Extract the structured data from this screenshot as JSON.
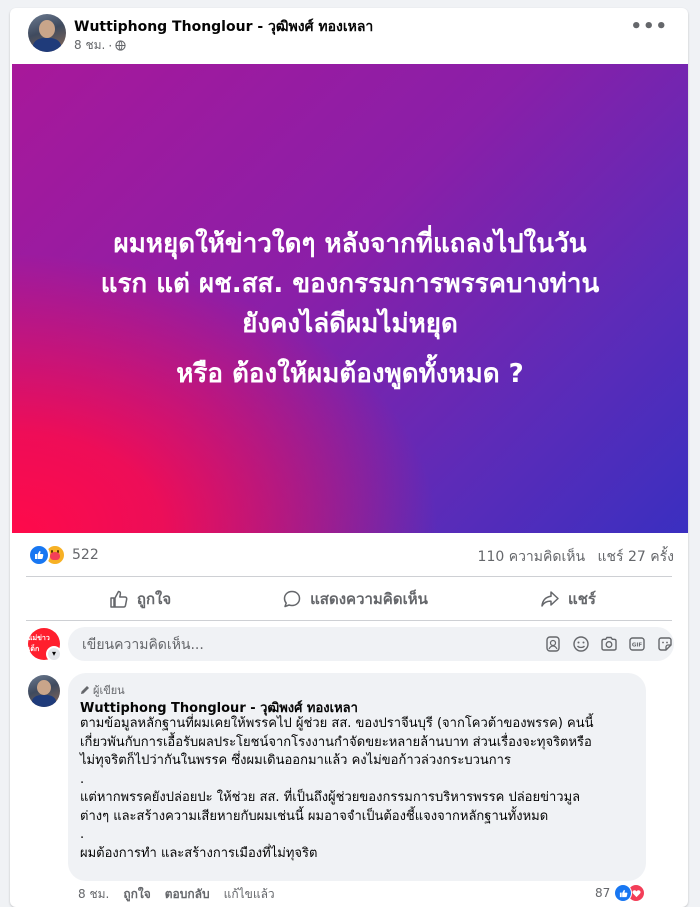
{
  "post": {
    "author": "Wuttiphong Thonglour - วุฒิพงศ์ ทองเหลา",
    "time": "8 ชม.",
    "separator": "·",
    "banner": {
      "line1": "ผมหยุดให้ข่าวใดๆ หลังจากที่แถลงไปในวัน",
      "line2": "แรก แต่ ผช.สส. ของกรรมการพรรคบางท่าน",
      "line3": "ยังคงไล่ดีผมไม่หยุด",
      "line4": "หรือ ต้องให้ผมต้องพูดทั้งหมด ?",
      "colors": [
        "#ff0a4a",
        "#a8189a",
        "#3a2fc0"
      ]
    }
  },
  "stats": {
    "reactions": "522",
    "comments": "110 ความคิดเห็น",
    "shares": "แชร์ 27 ครั้ง"
  },
  "actions": {
    "like": "ถูกใจ",
    "comment": "แสดงความคิดเห็น",
    "share": "แชร์"
  },
  "composer": {
    "placeholder": "เขียนความคิดเห็น...",
    "avatar_text": "แม่ข่าวเด็ก"
  },
  "comment": {
    "badge": "ผู้เขียน",
    "author": "Wuttiphong Thonglour - วุฒิพงศ์ ทองเหลา",
    "lines": [
      "ตามข้อมูลหลักฐานที่ผมเคยให้พรรคไป ผู้ช่วย สส. ของปราจีนบุรี (จากโควต้าของพรรค) คนนี้",
      "เกี่ยวพันกับการเอื้อรับผลประโยชน์จากโรงงานกำจัดขยะหลายล้านบาท ส่วนเรื่องจะทุจริตหรือ",
      "ไม่ทุจริตก็ไปว่ากันในพรรค ซึ่งผมเดินออกมาแล้ว คงไม่ขอก้าวล่วงกระบวนการ",
      ".",
      "แต่หากพรรคยังปล่อยปะ ให้ช่วย สส. ที่เป็นถึงผู้ช่วยของกรรมการบริหารพรรค ปล่อยข่าวมูล",
      "ต่างๆ และสร้างความเสียหายกับผมเช่นนี้ ผมอาจจำเป็นต้องชี้แจงจากหลักฐานทั้งหมด",
      ".",
      "ผมต้องการทำ และสร้างการเมืองที่ไม่ทุจริต"
    ],
    "time": "8 ชม.",
    "like": "ถูกใจ",
    "reply": "ตอบกลับ",
    "edited": "แก้ไขแล้ว",
    "reaction_count": "87"
  },
  "colors": {
    "like_blue": "#1877f2",
    "love_red": "#f33e58",
    "muted_text": "#65676b"
  }
}
